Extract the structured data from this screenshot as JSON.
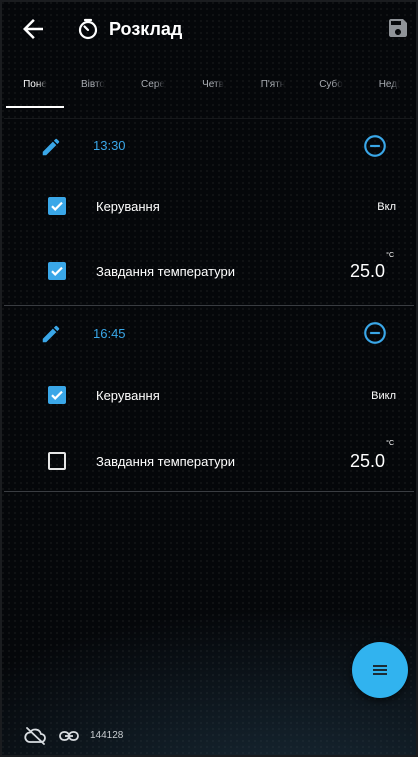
{
  "app": {
    "title": "Розклад"
  },
  "tabs": [
    {
      "label": "Поне",
      "active": true
    },
    {
      "label": "Вівто",
      "active": false
    },
    {
      "label": "Сере",
      "active": false
    },
    {
      "label": "Четв",
      "active": false
    },
    {
      "label": "П'ятн",
      "active": false
    },
    {
      "label": "Субо",
      "active": false
    },
    {
      "label": "Неді",
      "active": false
    }
  ],
  "schedule": [
    {
      "time": "13:30",
      "control": {
        "label": "Керування",
        "checked": true,
        "value": "Вкл"
      },
      "temperature": {
        "label": "Завдання температури",
        "checked": true,
        "value": "25.0",
        "unit": "°C"
      }
    },
    {
      "time": "16:45",
      "control": {
        "label": "Керування",
        "checked": true,
        "value": "Викл"
      },
      "temperature": {
        "label": "Завдання температури",
        "checked": false,
        "value": "25.0",
        "unit": "°C"
      }
    }
  ],
  "footer": {
    "device_id": "144128"
  },
  "icons": {
    "back": "arrow-back-icon",
    "title": "timer-icon",
    "save": "save-icon",
    "edit": "pencil-icon",
    "remove": "remove-circle-icon",
    "fab": "menu-icon",
    "cloud": "cloud-off-icon",
    "link": "link-icon"
  },
  "colors": {
    "accent": "#3aa7e8",
    "fab": "#31b3ef",
    "background": "#05070a"
  }
}
